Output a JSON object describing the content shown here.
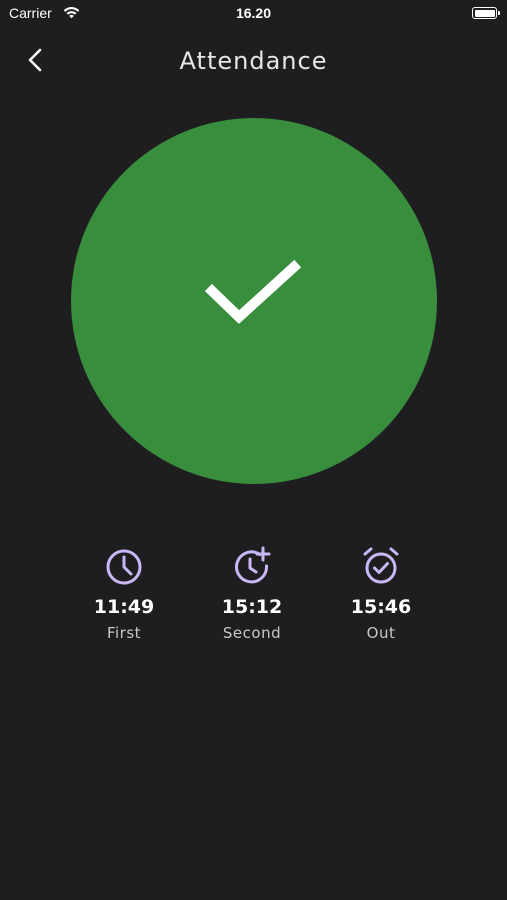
{
  "status_bar": {
    "carrier": "Carrier",
    "time": "16.20"
  },
  "header": {
    "title": "Attendance",
    "back_icon": "chevron-left-icon"
  },
  "status": {
    "state": "checked",
    "icon": "check-icon",
    "color": "#388e3c"
  },
  "stats": [
    {
      "time": "11:49",
      "label": "First",
      "icon": "clock-icon"
    },
    {
      "time": "15:12",
      "label": "Second",
      "icon": "clock-plus-icon"
    },
    {
      "time": "15:46",
      "label": "Out",
      "icon": "alarm-check-icon"
    }
  ],
  "colors": {
    "background": "#1e1e20",
    "accent_icon": "#c9b8f5",
    "success": "#388e3c"
  }
}
